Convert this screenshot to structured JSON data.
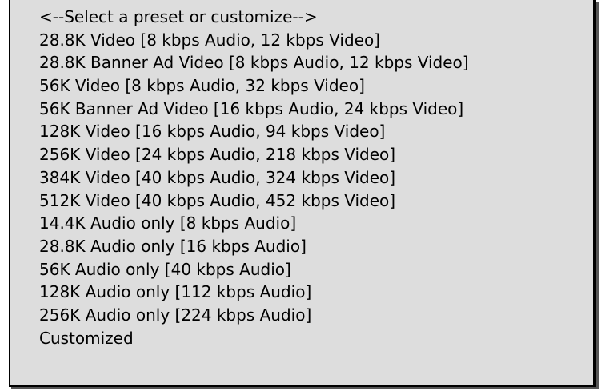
{
  "menu": {
    "items": [
      "<--Select a preset or customize-->",
      "28.8K Video [8 kbps Audio, 12 kbps Video]",
      "28.8K Banner Ad Video [8 kbps Audio, 12 kbps Video]",
      "56K Video [8 kbps Audio, 32 kbps Video]",
      "56K Banner Ad Video [16 kbps Audio, 24 kbps Video]",
      "128K Video [16 kbps Audio, 94 kbps Video]",
      "256K Video [24 kbps Audio, 218 kbps Video]",
      "384K Video [40 kbps Audio, 324 kbps Video]",
      "512K Video [40 kbps Audio, 452 kbps Video]",
      "14.4K Audio only [8 kbps Audio]",
      "28.8K Audio only [16 kbps Audio]",
      "56K Audio only [40 kbps Audio]",
      "128K Audio only [112 kbps Audio]",
      "256K Audio only [224 kbps Audio]",
      "Customized"
    ]
  },
  "colors": {
    "menu_background": "#dddddd",
    "border": "#000000",
    "text": "#000000"
  }
}
